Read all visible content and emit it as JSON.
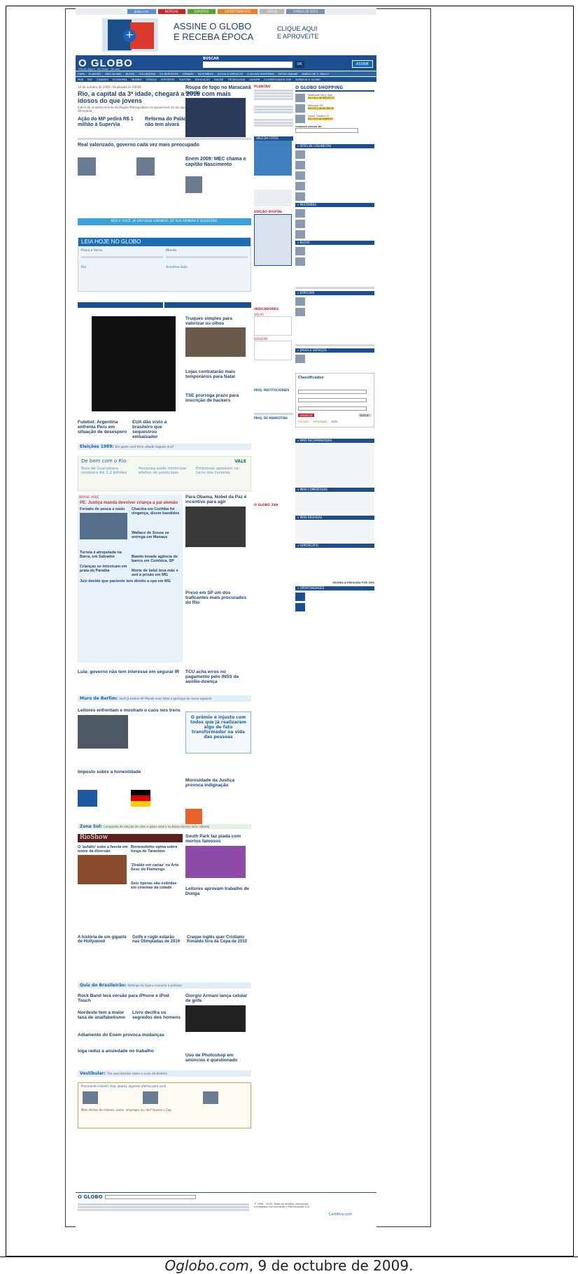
{
  "topbar": [
    "globo.com",
    "NOTÍCIAS",
    "ESPORTES",
    "ENTRETENIMENTO",
    "VÍDEOS",
    "FAMÍLIA DE SITES"
  ],
  "banner": {
    "line1": "ASSINE O GLOBO",
    "line2": "E RECEBA ÉPOCA",
    "cta1": "CLIQUE AQUI",
    "cta2": "E APROVEITE"
  },
  "header": {
    "logo": "O GLOBO",
    "search_label": "BUSCAR",
    "ok": "OK",
    "assine": "ASSINE",
    "opt1": "Edição digital",
    "opt2": "No Globo",
    "opt3": "Na web"
  },
  "nav1": [
    "CAPA",
    "PLANTÃO",
    "MEU GLOBO",
    "BLOGS",
    "COLUNISTAS",
    "EU-REPÓRTER",
    "OPINIÃO",
    "MULTIMÍDIA",
    "JOGOS E SERVIÇOS",
    "O GLOBO SHOPPING",
    "EXTRA ONLINE",
    "DIÁRIO DE S. PAULO"
  ],
  "nav2": [
    "PAÍS",
    "RIO",
    "CIDADES",
    "ECONOMIA",
    "MUNDO",
    "CIÊNCIA",
    "ESPORTES",
    "CULTURA",
    "EDUCAÇÃO",
    "SAÚDE",
    "TECNOLOGIA",
    "VIAGEM",
    "CLASSIFICADOS ZAP",
    "AGÊNCIA O GLOBO"
  ],
  "main": {
    "date": "10 de outubro de 2009 | Atualizada às 00h09",
    "lead": "Rio, a capital da 3ª idade, chegará a 2016 com mais idosos do que jovens",
    "lead_sub": "Índice de envelhecimento da Região Metropolitana se aproximará do da capital. Projeções consideram 2016 ano de Olimpíada",
    "h2a": "Ação do MP pedirá R$ 1 milhão à SuperVia",
    "h2b": "Reforma do Palácio do Planalto não tem alvará",
    "h3": "Real valorizado, governo cada vez mais preocupado",
    "cta": "NÓS E VOCÊ. JÁ SÃO DOIS GIRANDO. DÊ SUA OPINIÃO E SUGESTÃO.",
    "side1": "Roupa de fogo no Maracanã lotado",
    "side2": "Enem 2009: MEC chama o capitão Nascimento",
    "leia": "LEIA HOJE NO GLOBO",
    "leia_items": [
      "Prosa e Verso",
      "Mundo",
      "Rio",
      "Ancelmo Gois"
    ],
    "h4": "Truques simples para valorizar os olhos",
    "h5": "Lojas contratarão mais temporários para Natal",
    "h6": "TSE prorroga prazo para inscrição de hackers",
    "f1": "Futebol: Argentina enfrenta Peru em situação de desespero",
    "f2": "EUA dão visto a brasileiro que sequestrou embaixador",
    "eleicoes": "Eleições 1989:",
    "eleicoes_q": "Em quem você teria votado naquele ano?",
    "vale": "De bem com o Rio",
    "vale_logo": "VALE",
    "v1": "Baía de Guanabara receberá R$ 2,2 bilhões",
    "v2": "Pesquisa pode minimizar efeitos de pesticidas",
    "v3": "Empresas apostam no lucro das livreiras",
    "brasil": "BRASIL HOJE",
    "b1": "PE: Justiça manda devolver criança a pai alemão",
    "b2": "Chacina em Curitiba foi vingança, dizem bandidos",
    "b3": "Wallace de Souza se entrega em Manaus",
    "b4": "Feriado de pesca e nado",
    "b5": "Turista é atropelada na Barra, em Salvador",
    "b6": "Bando invade agência de banco em Cumbica, SP",
    "b7": "Crianças se intoxicam em praia da Paraíba",
    "b8": "Morte de bebê leva mãe e avó à prisão em MG",
    "b9": "Juiz decide que paciente tem direito a spa em MG",
    "obama": "Para Obama, Nobel da Paz é incentivo para agir",
    "preso": "Preso em SP um dos traficantes mais procurados do Rio",
    "lula": "Lula: governo não tem interesse em segurar IR",
    "tcu": "TCU acha erros no pagamento pelo INSS de auxílio-doença",
    "muro": "Muro de Berlim:",
    "muro_q": "Você já esteve lá? Mande suas fotos e participe do nosso especial",
    "leitores": "Leitores enfrentam e mostram o caos nos trens",
    "premio": "O prêmio é injusto com todos que já realizaram algo de fato transformador na vida das pessoas",
    "imposto": "Imposto sobre a honestidade",
    "moroso": "Morosidade da Justiça provoca indignação",
    "zona": "Zona Sul:",
    "zona_q": "Campanha de adoção de cães e gatos estará no Baixo Gávea neste sábado",
    "rioshow": "RioShow",
    "r1": "O 'asfalto' sobe a favela em nome da diversão",
    "r2": "Boneoutinho opina sobre longa de Tarantino",
    "r3": "'Ziraldo em cartaz' no Arte Sesc do Flamengo",
    "r4": "Seis óperas são exibidas em cinemas da cidade",
    "south": "South Park faz piada com mortos famosos",
    "letras": "Leitores aprovam trabalho de Dunga",
    "hist": "A história de um gigante de Hollywood",
    "golfe": "Golfe e rúgbi estarão nas Olimpíadas de 2016",
    "craque": "Craque inglês quer Cristiano Ronaldo fora da Copa de 2010",
    "quiz": "Quiz do Brasileirão:",
    "quiz_q": "Participe do Quiz e concorra a prêmios",
    "rock": "Rock Band terá versão para iPhone e iPod Touch",
    "armani": "Giorgio Armani lança celular de grife",
    "nordeste": "Nordeste tem a maior taxa de analfabetismo",
    "livro": "Livro decifra os segredos dos homens",
    "adiamento": "Adiamento do Enem provoca mudanças",
    "ioga": "Ioga reduz a ansiedade no trabalho",
    "photoshop": "Uso de Photoshop em anúncios é questionado",
    "vest": "Vestibular:",
    "vest_q": "Tire suas dúvidas sobre o curso de História",
    "zap_title": "Procurando imóvel? Veja, abaixo, algumas ofertas para você",
    "zap_more": "Mais ofertas de imóveis, autos, empregos ou não? Acesse o Zap."
  },
  "mid": {
    "plantao": "PLANTÃO",
    "enquete": "VALE DA FOTOS",
    "edicao": "EDIÇÃO DIGITAL",
    "indicadores": "INDICADORES",
    "dolar": "DÓLAR",
    "ibov": "IBOVESPA",
    "prod": "PROJ. INSTITUCIONAIS",
    "mkt": "PROJ. DE MARKETING",
    "o24": "O GLOBO 24H"
  },
  "right": {
    "shopping": "O GLOBO SHOPPING",
    "p1": "Notebook Sony Vaio",
    "p1v": "Em 10 x de R$225,23",
    "p2": "Motorola Z9",
    "p2v": "Em 10 x de R$ 69,90",
    "p3": "Home Theater LG",
    "p3v": "Em 10 x de R$69,90",
    "compare": "compare preços de",
    "colunistas": "» SITES DE COLUNISTAS",
    "multimidia": "» MULTIMÍDIA",
    "blogs": "» BLOGS",
    "especiais": "» ESPECIAIS",
    "jogos": "» JOGOS E SERVIÇOS",
    "classificados": "Classificados",
    "imoveis": "imóveis",
    "empregos": "empregos",
    "auto": "auto",
    "buscar": "buscar",
    "anunciar": "anunciar",
    "recomendadas": "» MAIS RECOMENDADAS",
    "comentadas": "» MAIS COMENTADAS",
    "enviadas": "» MAIS ENVIADAS",
    "horoscopo": "» HORÓSCOPO",
    "receba": "RECEBA A PREVISÃO POR SMS",
    "oportunidades": "» OPORTUNIDADES"
  },
  "footer": {
    "logo": "O GLOBO",
    "buscar": "OK",
    "copy": "© 1996 - 2009. Todos os direitos reservados a Infoglobo Comunicação e Participações S.A.",
    "cert": "Certifica.com"
  },
  "caption": {
    "site": "Oglobo.com",
    "rest": ", 9 de octubre de 2009."
  }
}
